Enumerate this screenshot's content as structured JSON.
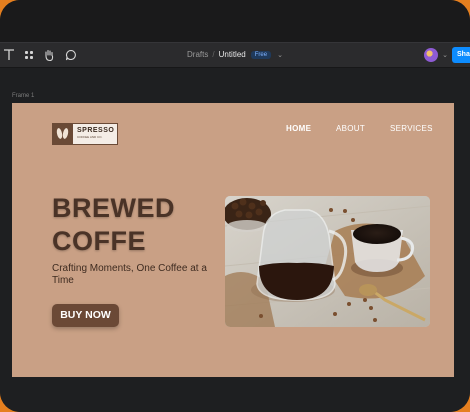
{
  "toolbar": {
    "tools": [
      "text-tool",
      "component-tool",
      "hand-tool",
      "comment-tool"
    ],
    "breadcrumb": {
      "folder": "Drafts",
      "separator": "/",
      "file": "Untitled",
      "badge": "Free"
    },
    "share_label": "Sha"
  },
  "canvas": {
    "frame_label": "Frame 1"
  },
  "site": {
    "logo": {
      "name": "SPRESSO",
      "tagline": "COFFEE AND CO."
    },
    "nav": [
      {
        "label": "HOME",
        "active": true
      },
      {
        "label": "ABOUT",
        "active": false
      },
      {
        "label": "SERVICES",
        "active": false
      }
    ],
    "headline_line1": "BREWED",
    "headline_line2": "COFFE",
    "subheadline": "Crafting Moments, One Coffee at a Time",
    "cta_label": "BUY NOW"
  },
  "colors": {
    "frame_bg": "#c9a085",
    "cta_bg": "#6b4936",
    "headline": "#4a3327",
    "share_button": "#0d8cff",
    "outer_border": "#e57f1f"
  }
}
